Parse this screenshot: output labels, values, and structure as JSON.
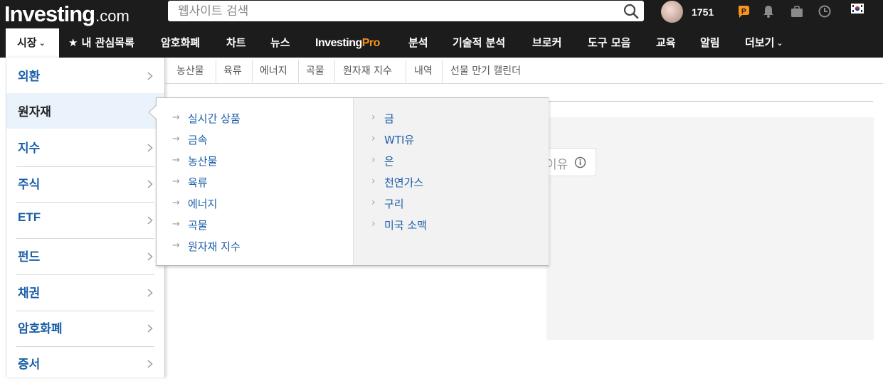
{
  "header": {
    "logo_main": "Investing",
    "logo_suffix": ".com",
    "search_placeholder": "웹사이트 검색",
    "user_score": "1751",
    "icons": [
      "search-icon",
      "avatar",
      "investingpro-icon",
      "bell-icon",
      "briefcase-icon",
      "clock-icon",
      "korea-flag-icon"
    ]
  },
  "nav": {
    "items": [
      {
        "label": "시장",
        "active": true
      },
      {
        "label": "★ 내 관심목록"
      },
      {
        "label": "암호화폐"
      },
      {
        "label": "차트"
      },
      {
        "label": "뉴스"
      },
      {
        "label_main": "Investing",
        "label_pro": "Pro"
      },
      {
        "label": "분석"
      },
      {
        "label": "기술적 분석"
      },
      {
        "label": "브로커"
      },
      {
        "label": "도구 모음"
      },
      {
        "label": "교육"
      },
      {
        "label": "알림"
      },
      {
        "label": "더보기"
      }
    ]
  },
  "subnav": {
    "items": [
      "농산물",
      "육류",
      "에너지",
      "곡물",
      "원자재 지수",
      "내역",
      "선물 만기 캘린더"
    ]
  },
  "market_menu": {
    "items": [
      "외환",
      "원자재",
      "지수",
      "주식",
      "ETF",
      "펀드",
      "채권",
      "암호화폐",
      "증서"
    ],
    "active": "원자재"
  },
  "commodity_flyout": {
    "left_links": [
      "실시간 상품",
      "금속",
      "농산물",
      "육류",
      "에너지",
      "곡물",
      "원자재 지수"
    ],
    "right_links": [
      "금",
      "WTI유",
      "은",
      "천연가스",
      "구리",
      "미국 소맥"
    ]
  },
  "content": {
    "tip_text": "이유"
  },
  "colors": {
    "topbar_bg": "#1c1c1c",
    "link_blue": "#1a5ea8",
    "pro_orange": "#f7931e",
    "active_item_bg": "#eaf2fb"
  }
}
